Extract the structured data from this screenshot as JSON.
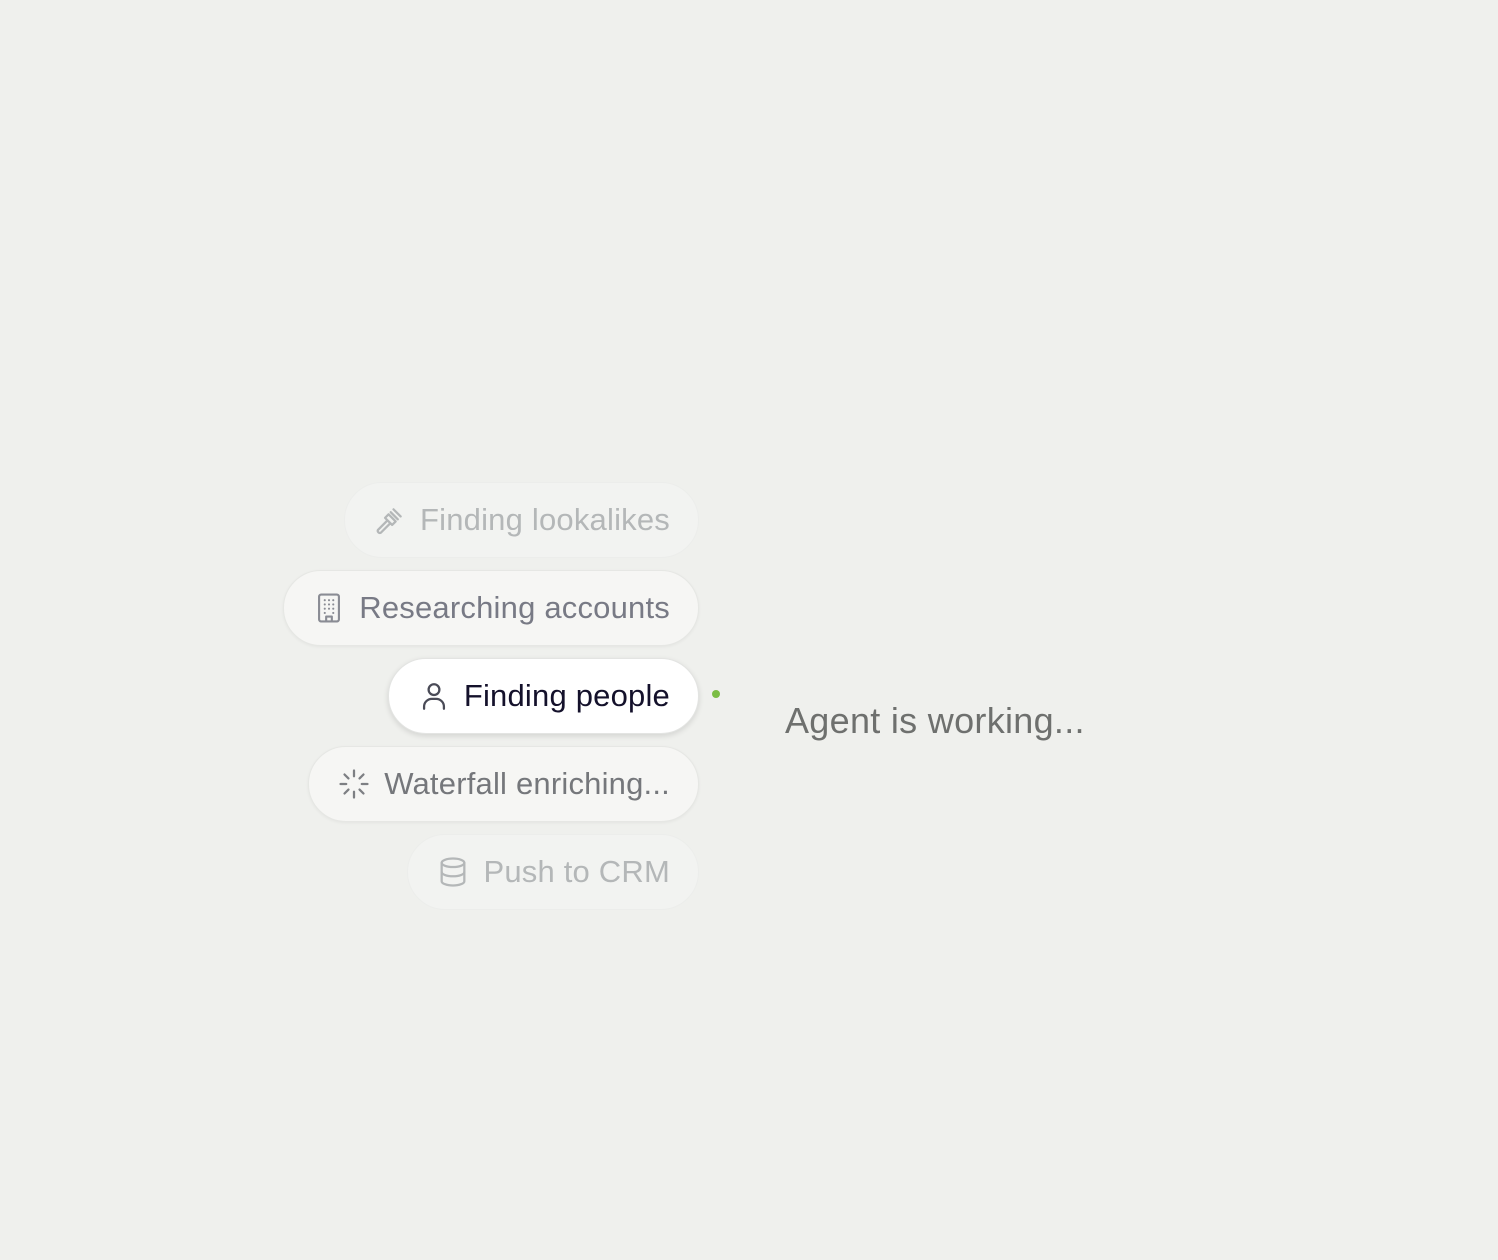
{
  "steps": [
    {
      "label": "Finding lookalikes",
      "icon": "gavel-icon",
      "state": "faded"
    },
    {
      "label": "Researching accounts",
      "icon": "building-icon",
      "state": "done"
    },
    {
      "label": "Finding people",
      "icon": "user-icon",
      "state": "active"
    },
    {
      "label": "Waterfall enriching...",
      "icon": "loader-icon",
      "state": "pending"
    },
    {
      "label": "Push to CRM",
      "icon": "database-icon",
      "state": "faded"
    }
  ],
  "status": {
    "text": "Agent is working...",
    "dot_color": "#7bbd44"
  }
}
